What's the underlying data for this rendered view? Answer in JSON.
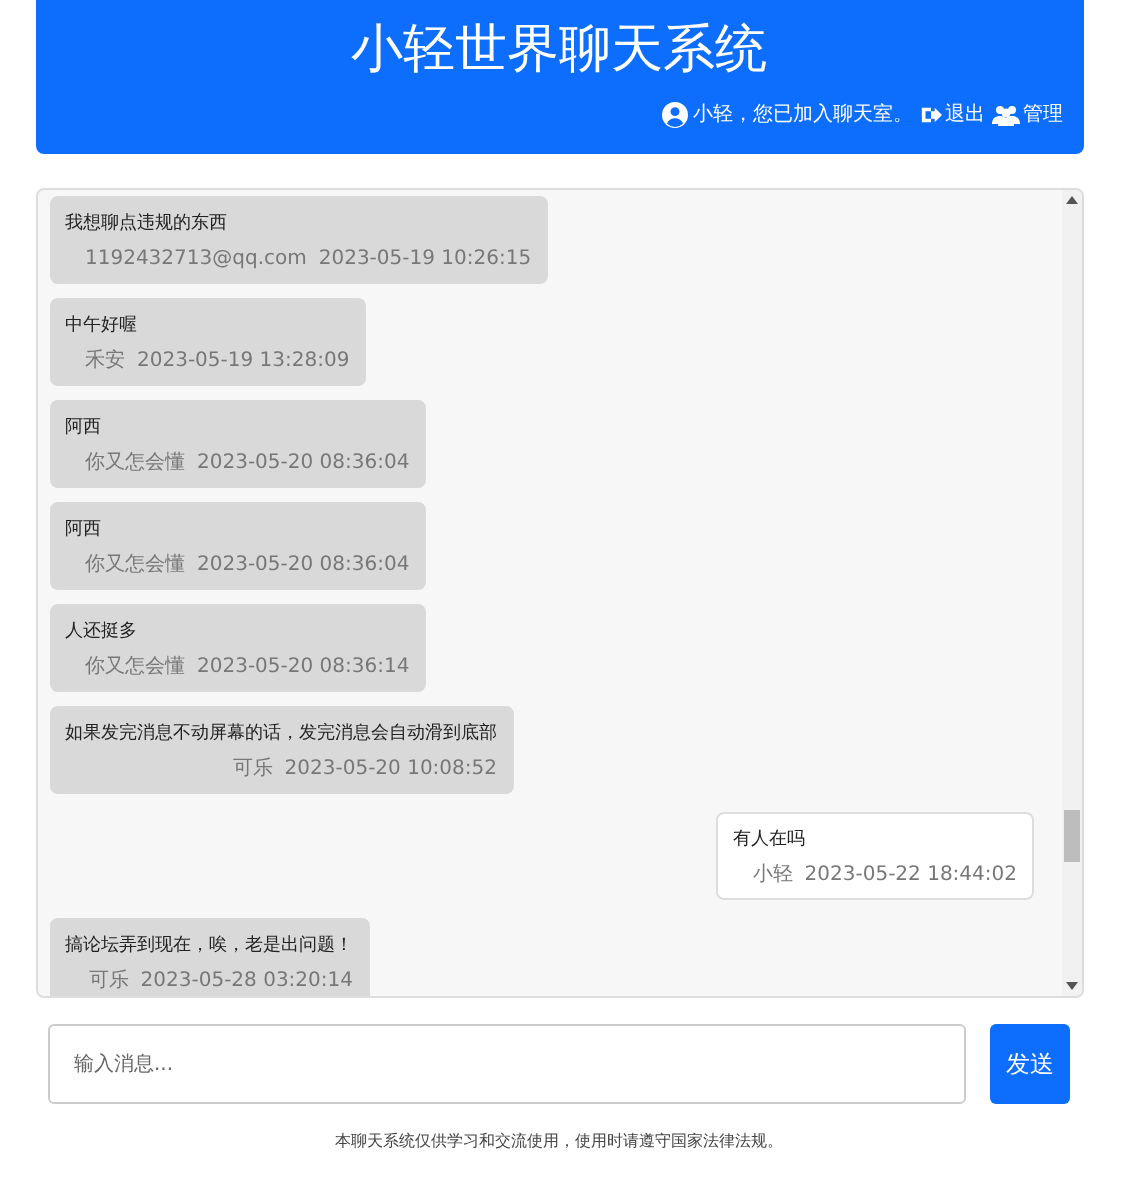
{
  "header": {
    "title": "小轻世界聊天系统",
    "status": "小轻，您已加入聊天室。",
    "links": [
      {
        "kind": "logout",
        "label": "退出"
      },
      {
        "kind": "admin",
        "label": "管理"
      }
    ]
  },
  "messages": [
    {
      "text": "我想聊点违规的东西",
      "sender": "1192432713@qq.com",
      "time": "2023-05-19 10:26:15",
      "mine": false
    },
    {
      "text": "中午好喔",
      "sender": "禾安",
      "time": "2023-05-19 13:28:09",
      "mine": false
    },
    {
      "text": "阿西",
      "sender": "你又怎会懂",
      "time": "2023-05-20 08:36:04",
      "mine": false
    },
    {
      "text": "阿西",
      "sender": "你又怎会懂",
      "time": "2023-05-20 08:36:04",
      "mine": false
    },
    {
      "text": "人还挺多",
      "sender": "你又怎会懂",
      "time": "2023-05-20 08:36:14",
      "mine": false
    },
    {
      "text": "如果发完消息不动屏幕的话，发完消息会自动滑到底部",
      "sender": "可乐",
      "time": "2023-05-20 10:08:52",
      "mine": false
    },
    {
      "text": "有人在吗",
      "sender": "小轻",
      "time": "2023-05-22 18:44:02",
      "mine": true
    },
    {
      "text": "搞论坛弄到现在，唉，老是出问题！",
      "sender": "可乐",
      "time": "2023-05-28 03:20:14",
      "mine": false
    }
  ],
  "composer": {
    "placeholder": "输入消息...",
    "button": "发送"
  },
  "footer": "本聊天系统仅供学习和交流使用，使用时请遵守国家法律法规。"
}
